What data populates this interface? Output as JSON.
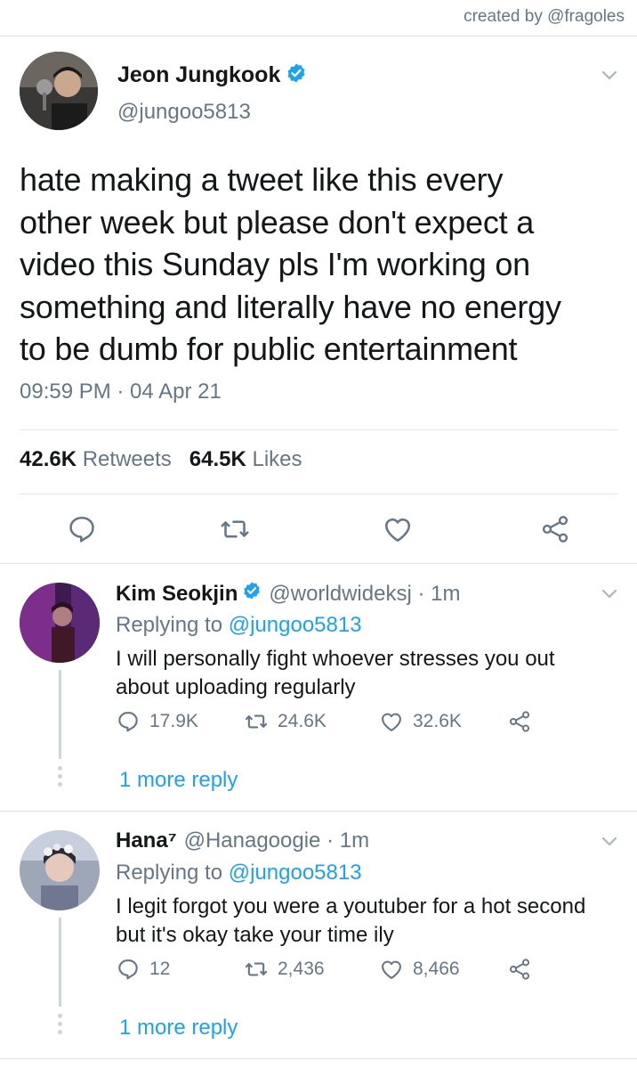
{
  "credit": "created by @fragoles",
  "main_tweet": {
    "name": "Jeon Jungkook",
    "handle": "@jungoo5813",
    "text_lines": [
      "hate making a tweet like this every",
      "other week but please don't expect a",
      "video this Sunday pls I'm working on",
      "something and literally have no energy",
      "to be dumb for public entertainment"
    ],
    "timestamp": "09:59 PM · 04 Apr 21",
    "retweets_count": "42.6K",
    "retweets_label": "Retweets",
    "likes_count": "64.5K",
    "likes_label": "Likes"
  },
  "replies": [
    {
      "name": "Kim Seokjin",
      "verified": true,
      "handle": "@worldwideksj · 1m",
      "replying_prefix": "Replying to",
      "replying_to": "@jungoo5813",
      "text_lines": [
        "I will personally fight whoever stresses you out",
        "about uploading regularly"
      ],
      "reply_count": "17.9K",
      "retweet_count": "24.6K",
      "like_count": "32.6K",
      "more_replies": "1 more reply"
    },
    {
      "name": "Hana⁷",
      "verified": false,
      "handle": "@Hanagoogie · 1m",
      "replying_prefix": "Replying to",
      "replying_to": "@jungoo5813",
      "text_lines": [
        "I legit forgot you were a youtuber for a hot second",
        "but it's okay take your time ily"
      ],
      "reply_count": "12",
      "retweet_count": "2,436",
      "like_count": "8,466",
      "more_replies": "1 more reply"
    }
  ],
  "colors": {
    "accent": "#1da1f2",
    "secondary_text": "#657786",
    "icon_gray": "#657786",
    "divider": "#e1e8ed"
  }
}
